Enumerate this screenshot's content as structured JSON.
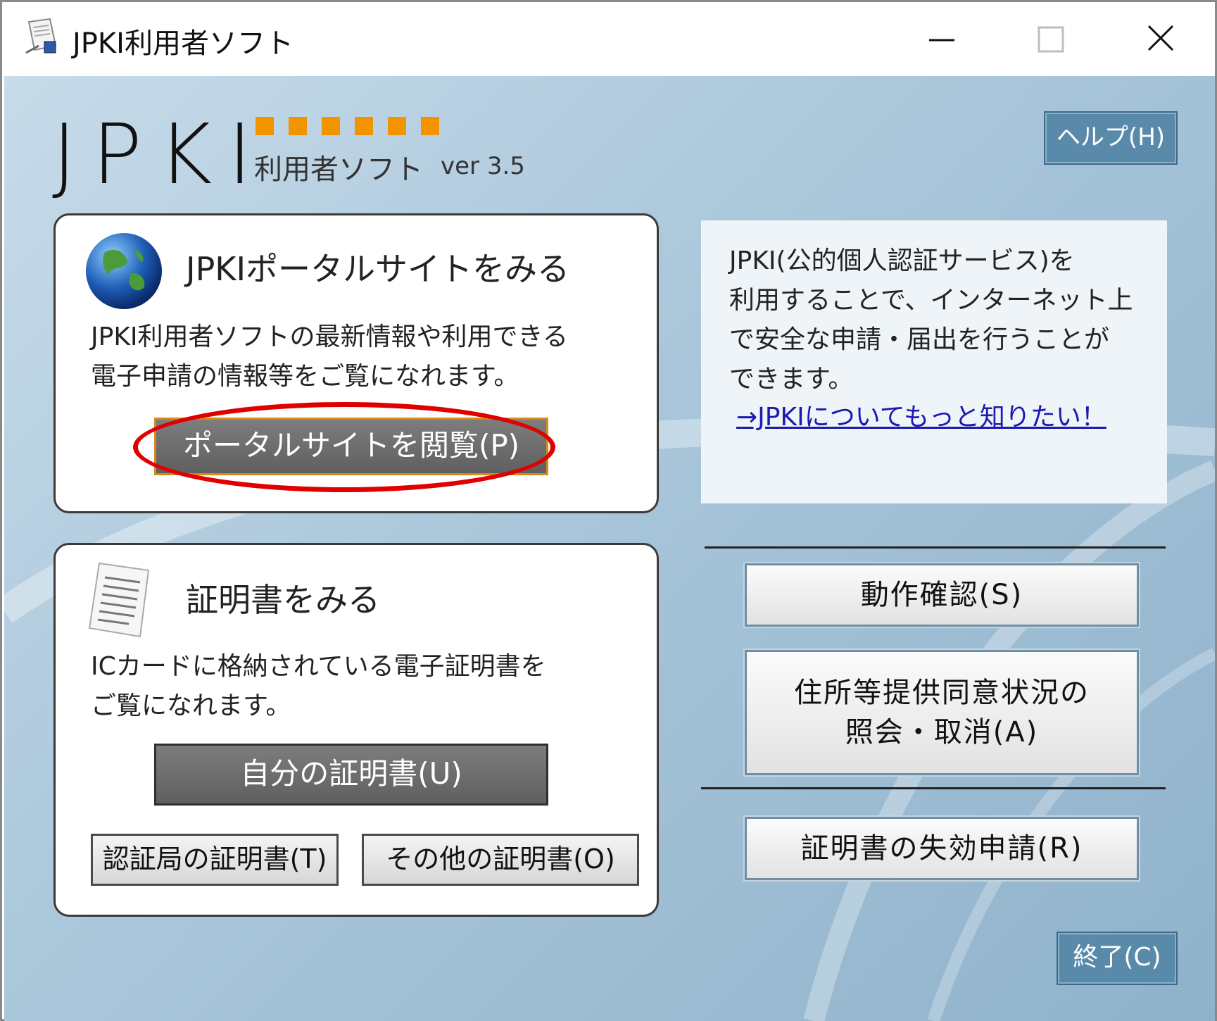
{
  "window": {
    "title": "JPKI利用者ソフト"
  },
  "logo": {
    "main": "JPKI",
    "subtitle": "利用者ソフト",
    "version": "ver 3.5",
    "accent_color": "#f29400"
  },
  "help_button": "ヘルプ(H)",
  "portal_panel": {
    "title": "JPKIポータルサイトをみる",
    "line1": "JPKI利用者ソフトの最新情報や利用できる",
    "line2": "電子申請の情報等をご覧になれます。",
    "button": "ポータルサイトを閲覧(P)",
    "icon": "globe-icon"
  },
  "cert_panel": {
    "title": "証明書をみる",
    "line1": "ICカードに格納されている電子証明書を",
    "line2": "ご覧になれます。",
    "my_cert_button": "自分の証明書(U)",
    "ca_cert_button": "認証局の証明書(T)",
    "other_cert_button": "その他の証明書(O)",
    "icon": "document-icon"
  },
  "info": {
    "line1": "JPKI(公的個人認証サービス)を",
    "line2": "利用することで、インターネット上",
    "line3": "で安全な申請・届出を行うことが",
    "line4": "できます。",
    "link": "→JPKIについてもっと知りたい！"
  },
  "right_buttons": {
    "check": "動作確認(S)",
    "address_line1": "住所等提供同意状況の",
    "address_line2": "照会・取消(A)",
    "revoke": "証明書の失効申請(R)"
  },
  "exit_button": "終了(C)",
  "highlight_color": "#e00000"
}
